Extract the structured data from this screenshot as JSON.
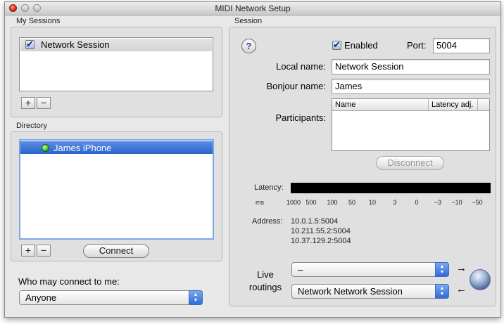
{
  "window": {
    "title": "MIDI Network Setup"
  },
  "my_sessions": {
    "heading": "My Sessions",
    "items": [
      {
        "label": "Network Session",
        "checked": true
      }
    ],
    "add_label": "+",
    "remove_label": "−"
  },
  "directory": {
    "heading": "Directory",
    "items": [
      {
        "label": "James iPhone",
        "status_color": "#3cbf2a"
      }
    ],
    "add_label": "+",
    "remove_label": "−",
    "connect_label": "Connect"
  },
  "who_may_connect": {
    "label": "Who may connect to me:",
    "value": "Anyone"
  },
  "session": {
    "heading": "Session",
    "help_label": "?",
    "enabled_label": "Enabled",
    "enabled": true,
    "port_label": "Port:",
    "port_value": "5004",
    "local_name_label": "Local name:",
    "local_name_value": "Network Session",
    "bonjour_name_label": "Bonjour name:",
    "bonjour_name_value": "James",
    "participants_label": "Participants:",
    "participants_columns": [
      "Name",
      "Latency adj."
    ],
    "disconnect_label": "Disconnect",
    "latency_label": "Latency:",
    "latency_unit": "ms",
    "latency_ticks": [
      "1000",
      "500",
      "100",
      "50",
      "10",
      "3",
      "0",
      "−3",
      "−10",
      "−50"
    ],
    "address_label": "Address:",
    "addresses": [
      "10.0.1.5:5004",
      "10.211.55.2:5004",
      "10.37.129.2:5004"
    ],
    "live_routings_label_1": "Live",
    "live_routings_label_2": "routings",
    "routing_in_value": "–",
    "routing_out_value": "Network Network Session",
    "arrow_right": "→",
    "arrow_left": "←"
  },
  "colors": {
    "selection_blue": "#3a73d8",
    "window_bg": "#e8e8e8",
    "latency_bar": "#000000"
  }
}
